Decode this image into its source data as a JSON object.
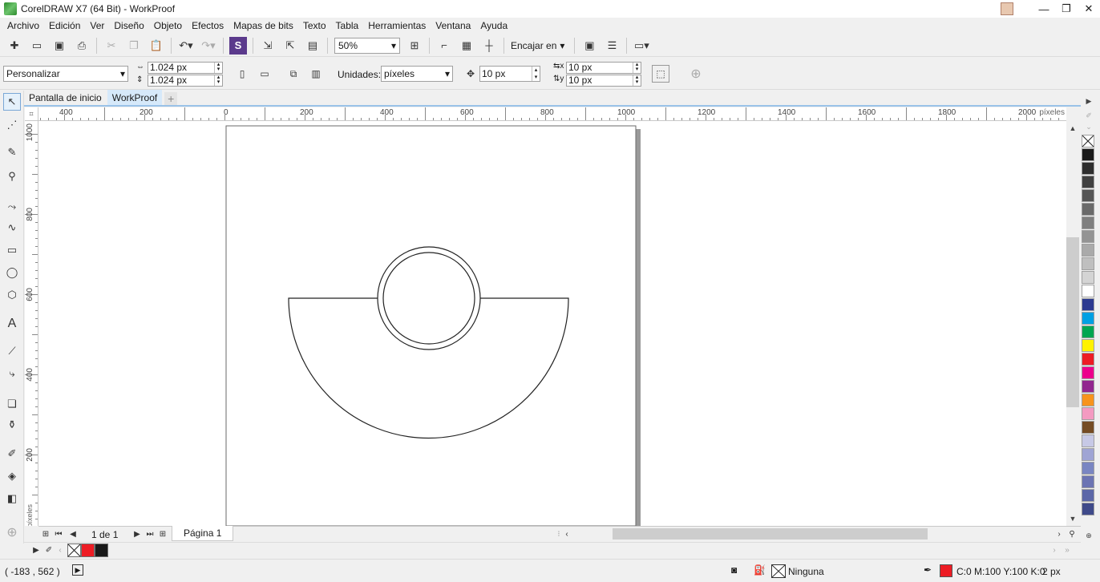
{
  "window": {
    "title": "CorelDRAW X7 (64 Bit) - WorkProof",
    "minimize": "—",
    "maximize": "❐",
    "close": "✕"
  },
  "menu": [
    "Archivo",
    "Edición",
    "Ver",
    "Diseño",
    "Objeto",
    "Efectos",
    "Mapas de bits",
    "Texto",
    "Tabla",
    "Herramientas",
    "Ventana",
    "Ayuda"
  ],
  "toolbar": {
    "zoom": "50%",
    "snap_to": "Encajar en"
  },
  "property_bar": {
    "page_preset": "Personalizar",
    "width": "1.024 px",
    "height": "1.024 px",
    "units_label": "Unidades:",
    "units": "píxeles",
    "nudge": "10 px",
    "dup_x": "10 px",
    "dup_y": "10 px"
  },
  "tabs": {
    "home": "Pantalla de inicio",
    "document": "WorkProof",
    "add": "+"
  },
  "rulers": {
    "units": "píxeles",
    "h_labels": [
      "400",
      "200",
      "0",
      "200",
      "400",
      "600",
      "800",
      "1000",
      "1200",
      "1400",
      "1600",
      "1800",
      "2000"
    ],
    "v_labels": [
      "1000",
      "800",
      "600",
      "400",
      "200"
    ],
    "v_units": "píxeles"
  },
  "page_nav": {
    "counter": "1 de 1",
    "page_tab": "Página 1"
  },
  "palette": {
    "colors": [
      "#1a1a1a",
      "#2e2e2e",
      "#404040",
      "#555555",
      "#6a6a6a",
      "#7f7f7f",
      "#949494",
      "#aaaaaa",
      "#bfbfbf",
      "#d4d4d4",
      "#ffffff",
      "#2b3990",
      "#00a0e3",
      "#00a651",
      "#fff200",
      "#ed1c24",
      "#ec008c",
      "#92278f",
      "#f7941d",
      "#f49ac1",
      "#754c24",
      "#c7c9e6",
      "#9fa4d4",
      "#7a86c2",
      "#6c74b3",
      "#5c67a8",
      "#3f4a8a"
    ]
  },
  "doc_palette": {
    "colors": [
      "#ed1c24",
      "#1a1a1a"
    ]
  },
  "status": {
    "coords": "( -183 , 562  )",
    "fill_label": "Ninguna",
    "outline_color_text": "C:0 M:100 Y:100 K:0",
    "outline_width": "2 px",
    "outline_color": "#ed1c24"
  }
}
